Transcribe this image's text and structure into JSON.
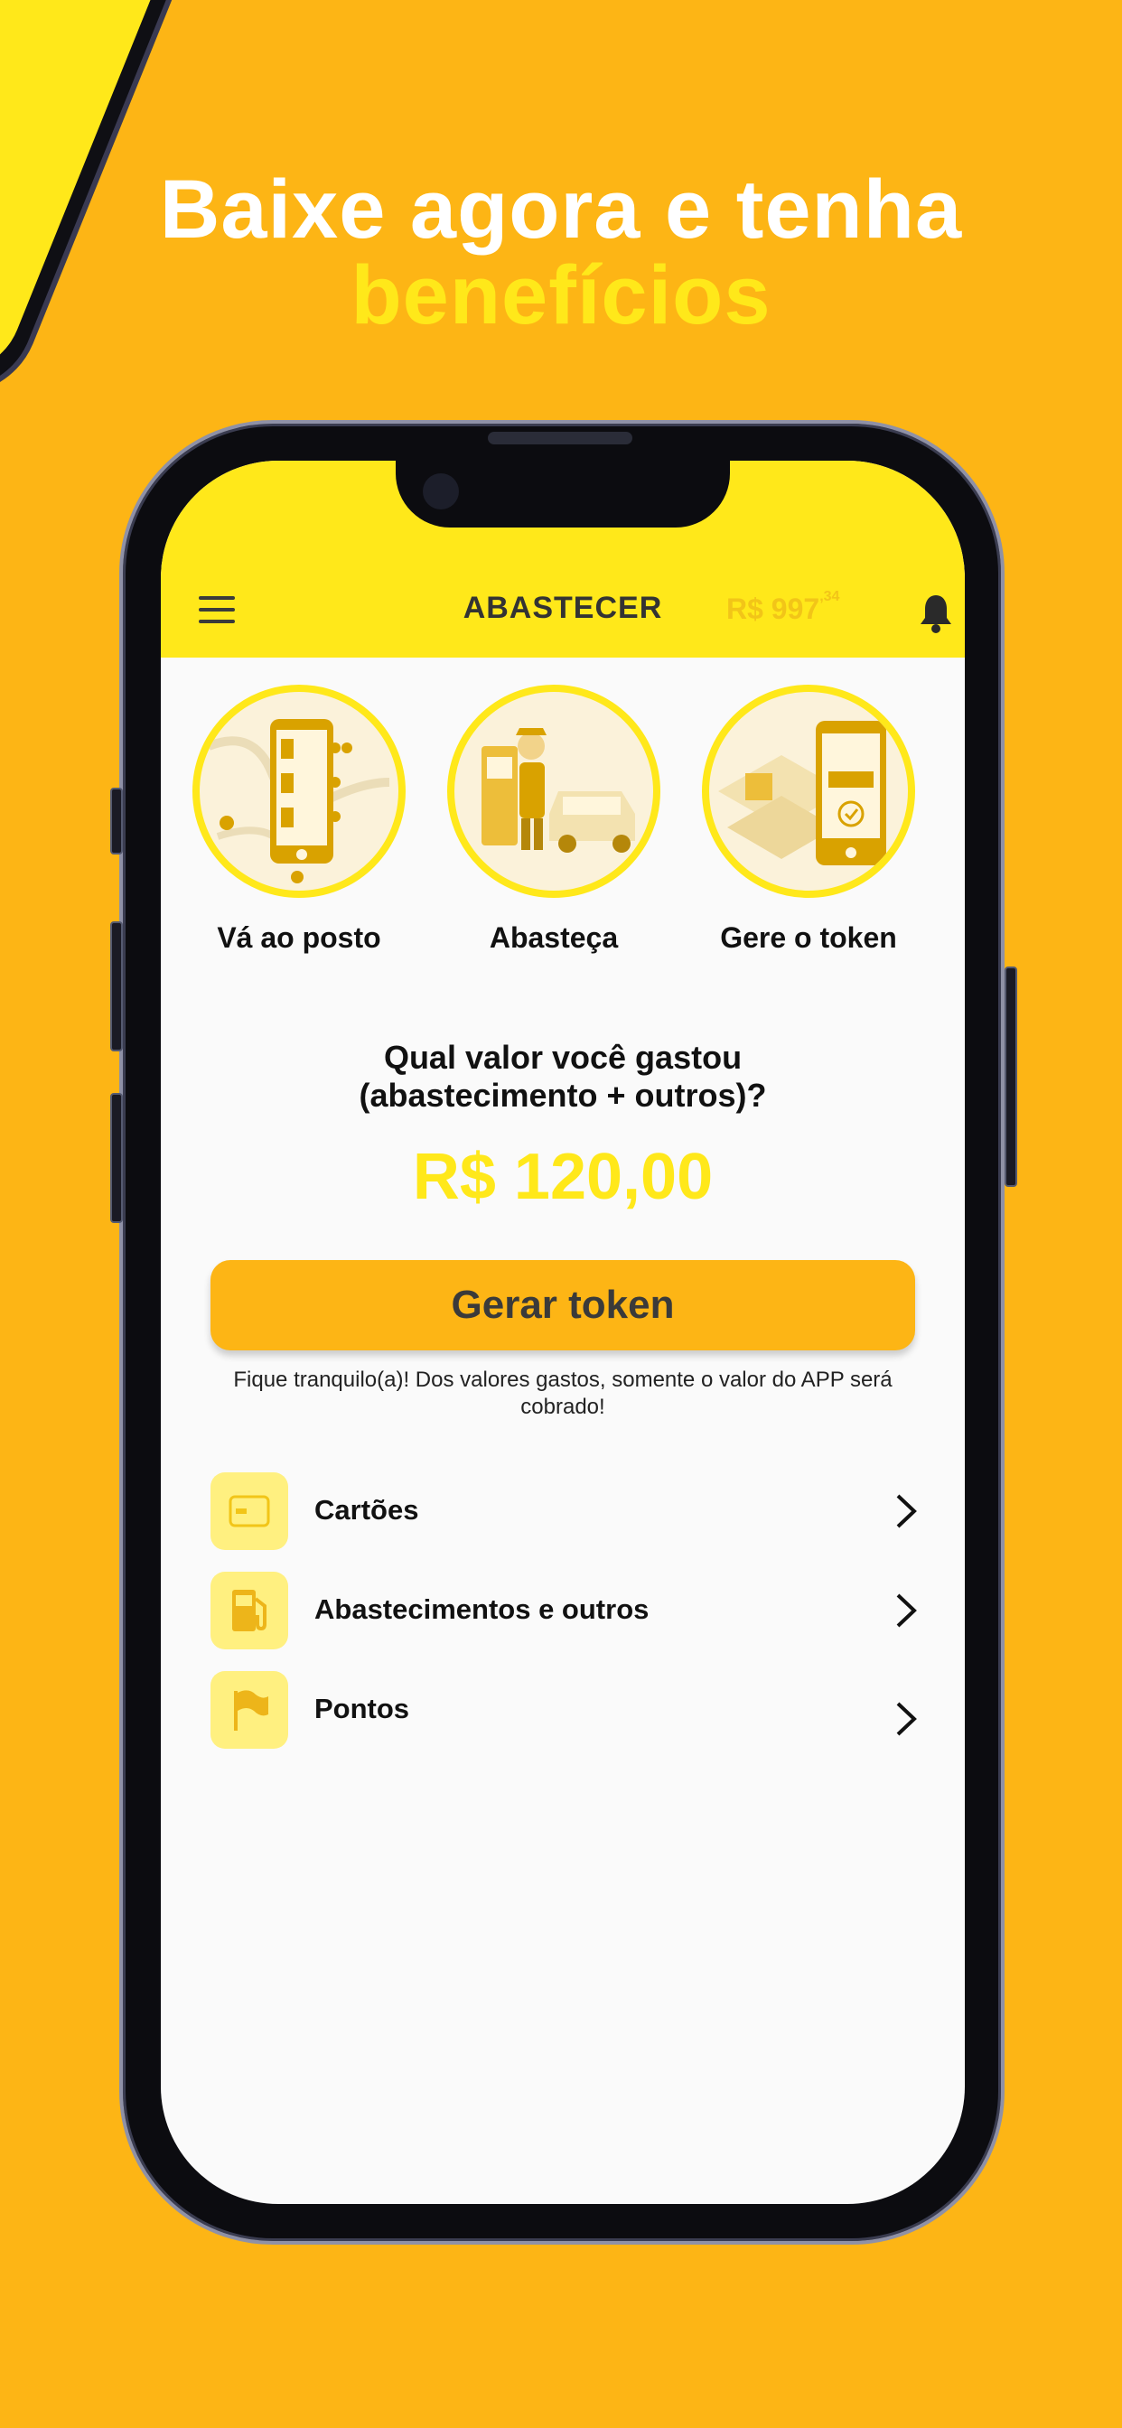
{
  "headline": {
    "line1": "Baixe agora e tenha",
    "line2": "benefícios"
  },
  "appbar": {
    "title": "ABASTECER",
    "balance_main": "R$ 997",
    "balance_cents": ",34",
    "menu_icon": "hamburger-menu-icon",
    "bell_icon": "bell-icon"
  },
  "steps": [
    {
      "label": "Vá ao posto",
      "illustration": "phone-map-icon"
    },
    {
      "label": "Abasteça",
      "illustration": "fuel-attendant-icon"
    },
    {
      "label": "Gere o token",
      "illustration": "phone-token-icon"
    }
  ],
  "question": {
    "line1": "Qual valor você gastou",
    "line2": "(abastecimento + outros)?"
  },
  "amount": "R$ 120,00",
  "cta_label": "Gerar token",
  "note": "Fique tranquilo(a)! Dos valores gastos, somente o valor do APP será cobrado!",
  "menu": [
    {
      "label": "Cartões",
      "icon": "credit-card-icon"
    },
    {
      "label": "Abastecimentos e outros",
      "icon": "fuel-pump-icon"
    },
    {
      "label": "Pontos",
      "icon": "flag-icon"
    }
  ],
  "colors": {
    "background": "#FDB515",
    "accent_yellow": "#FFE81A",
    "icon_tile": "#FFF080",
    "illustration": "#D9A200"
  }
}
